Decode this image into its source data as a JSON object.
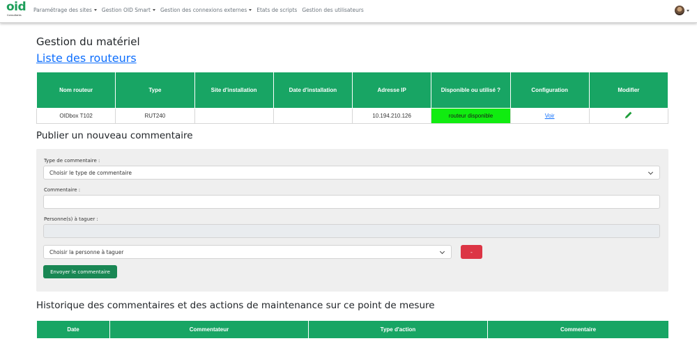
{
  "logo": {
    "main": "oid",
    "sub": "Consultants"
  },
  "nav": {
    "items": [
      {
        "label": "Paramétrage des sites",
        "dropdown": true
      },
      {
        "label": "Gestion OID Smart",
        "dropdown": true
      },
      {
        "label": "Gestion des connexions externes",
        "dropdown": true
      },
      {
        "label": "Etats de scripts",
        "dropdown": false
      },
      {
        "label": "Gestion des utilisateurs",
        "dropdown": false
      }
    ]
  },
  "page": {
    "title": "Gestion du matériel",
    "subtitle": "Liste des routeurs"
  },
  "routers": {
    "headers": [
      "Nom routeur",
      "Type",
      "Site d'installation",
      "Date d'installation",
      "Adresse IP",
      "Disponible ou utilisé ?",
      "Configuration",
      "Modifier"
    ],
    "rows": [
      {
        "name": "OIDbox T102",
        "type": "RUT240",
        "site": "",
        "date": "",
        "ip": "10.194.210.126",
        "status": "routeur disponible",
        "config": "Voir"
      }
    ]
  },
  "comment_form": {
    "heading": "Publier un nouveau commentaire",
    "type_label": "Type de commentaire :",
    "type_value": "Choisir le type de commentaire",
    "comment_label": "Commentaire :",
    "comment_value": "",
    "tag_label": "Personne(s) à taguer :",
    "tag_value": "",
    "person_value": "Choisir la personne à taguer",
    "remove_label": "-",
    "submit_label": "Envoyer le commentaire"
  },
  "history": {
    "heading": "Historique des commentaires et des actions de maintenance sur ce point de mesure",
    "headers": [
      "Date",
      "Commentateur",
      "Type d'action",
      "Commentaire"
    ]
  },
  "colors": {
    "header_green": "#18a564",
    "status_green": "#10ec10",
    "link_blue": "#0d6efd",
    "danger": "#dc3545",
    "success": "#198754"
  },
  "icons": [
    "user-avatar",
    "pencil-icon",
    "chevron-down-icon",
    "caret-down-icon"
  ]
}
